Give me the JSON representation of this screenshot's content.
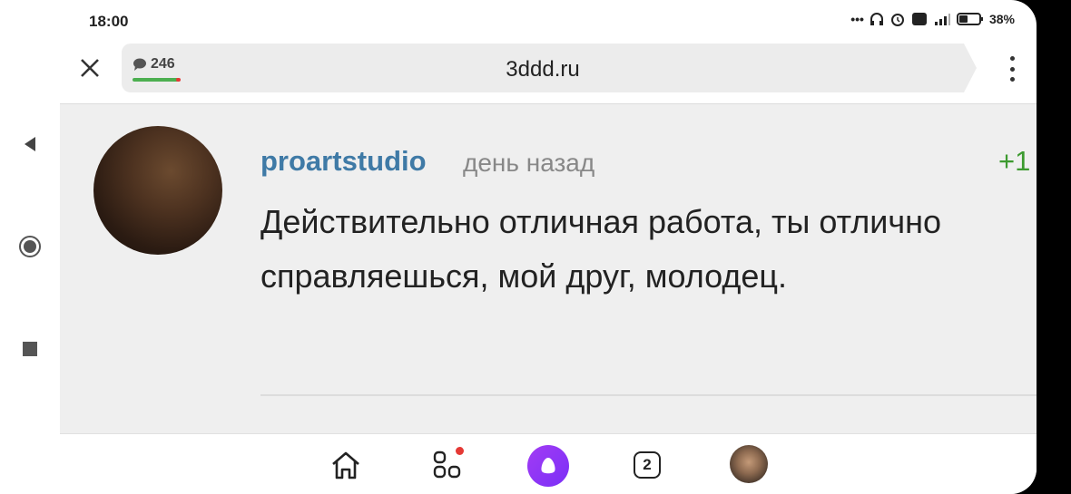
{
  "status": {
    "time": "18:00",
    "battery": "38%"
  },
  "browser": {
    "url": "3ddd.ru",
    "comments_count": "246"
  },
  "comment": {
    "author": "proartstudio",
    "time_ago": "день назад",
    "score": "+1",
    "text": "Действительно отличная работа, ты отлично справляешься, мой друг, молодец."
  },
  "bottom_nav": {
    "tabs_count": "2"
  },
  "colors": {
    "author": "#3f7aa6",
    "score": "#3c9a2f",
    "alice": "#8a35f5"
  }
}
